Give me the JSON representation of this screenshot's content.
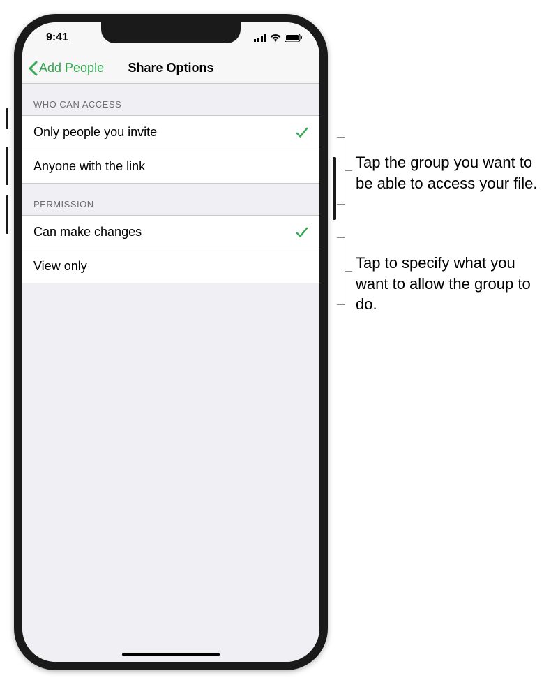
{
  "status_bar": {
    "time": "9:41"
  },
  "nav": {
    "back_label": "Add People",
    "title": "Share Options"
  },
  "sections": [
    {
      "header": "WHO CAN ACCESS",
      "items": [
        {
          "label": "Only people you invite",
          "selected": true
        },
        {
          "label": "Anyone with the link",
          "selected": false
        }
      ]
    },
    {
      "header": "PERMISSION",
      "items": [
        {
          "label": "Can make changes",
          "selected": true
        },
        {
          "label": "View only",
          "selected": false
        }
      ]
    }
  ],
  "callouts": [
    "Tap the group you want to be able to access your file.",
    "Tap to specify what you want to allow the group to do."
  ],
  "colors": {
    "accent": "#34a853",
    "bg": "#efeff4"
  }
}
